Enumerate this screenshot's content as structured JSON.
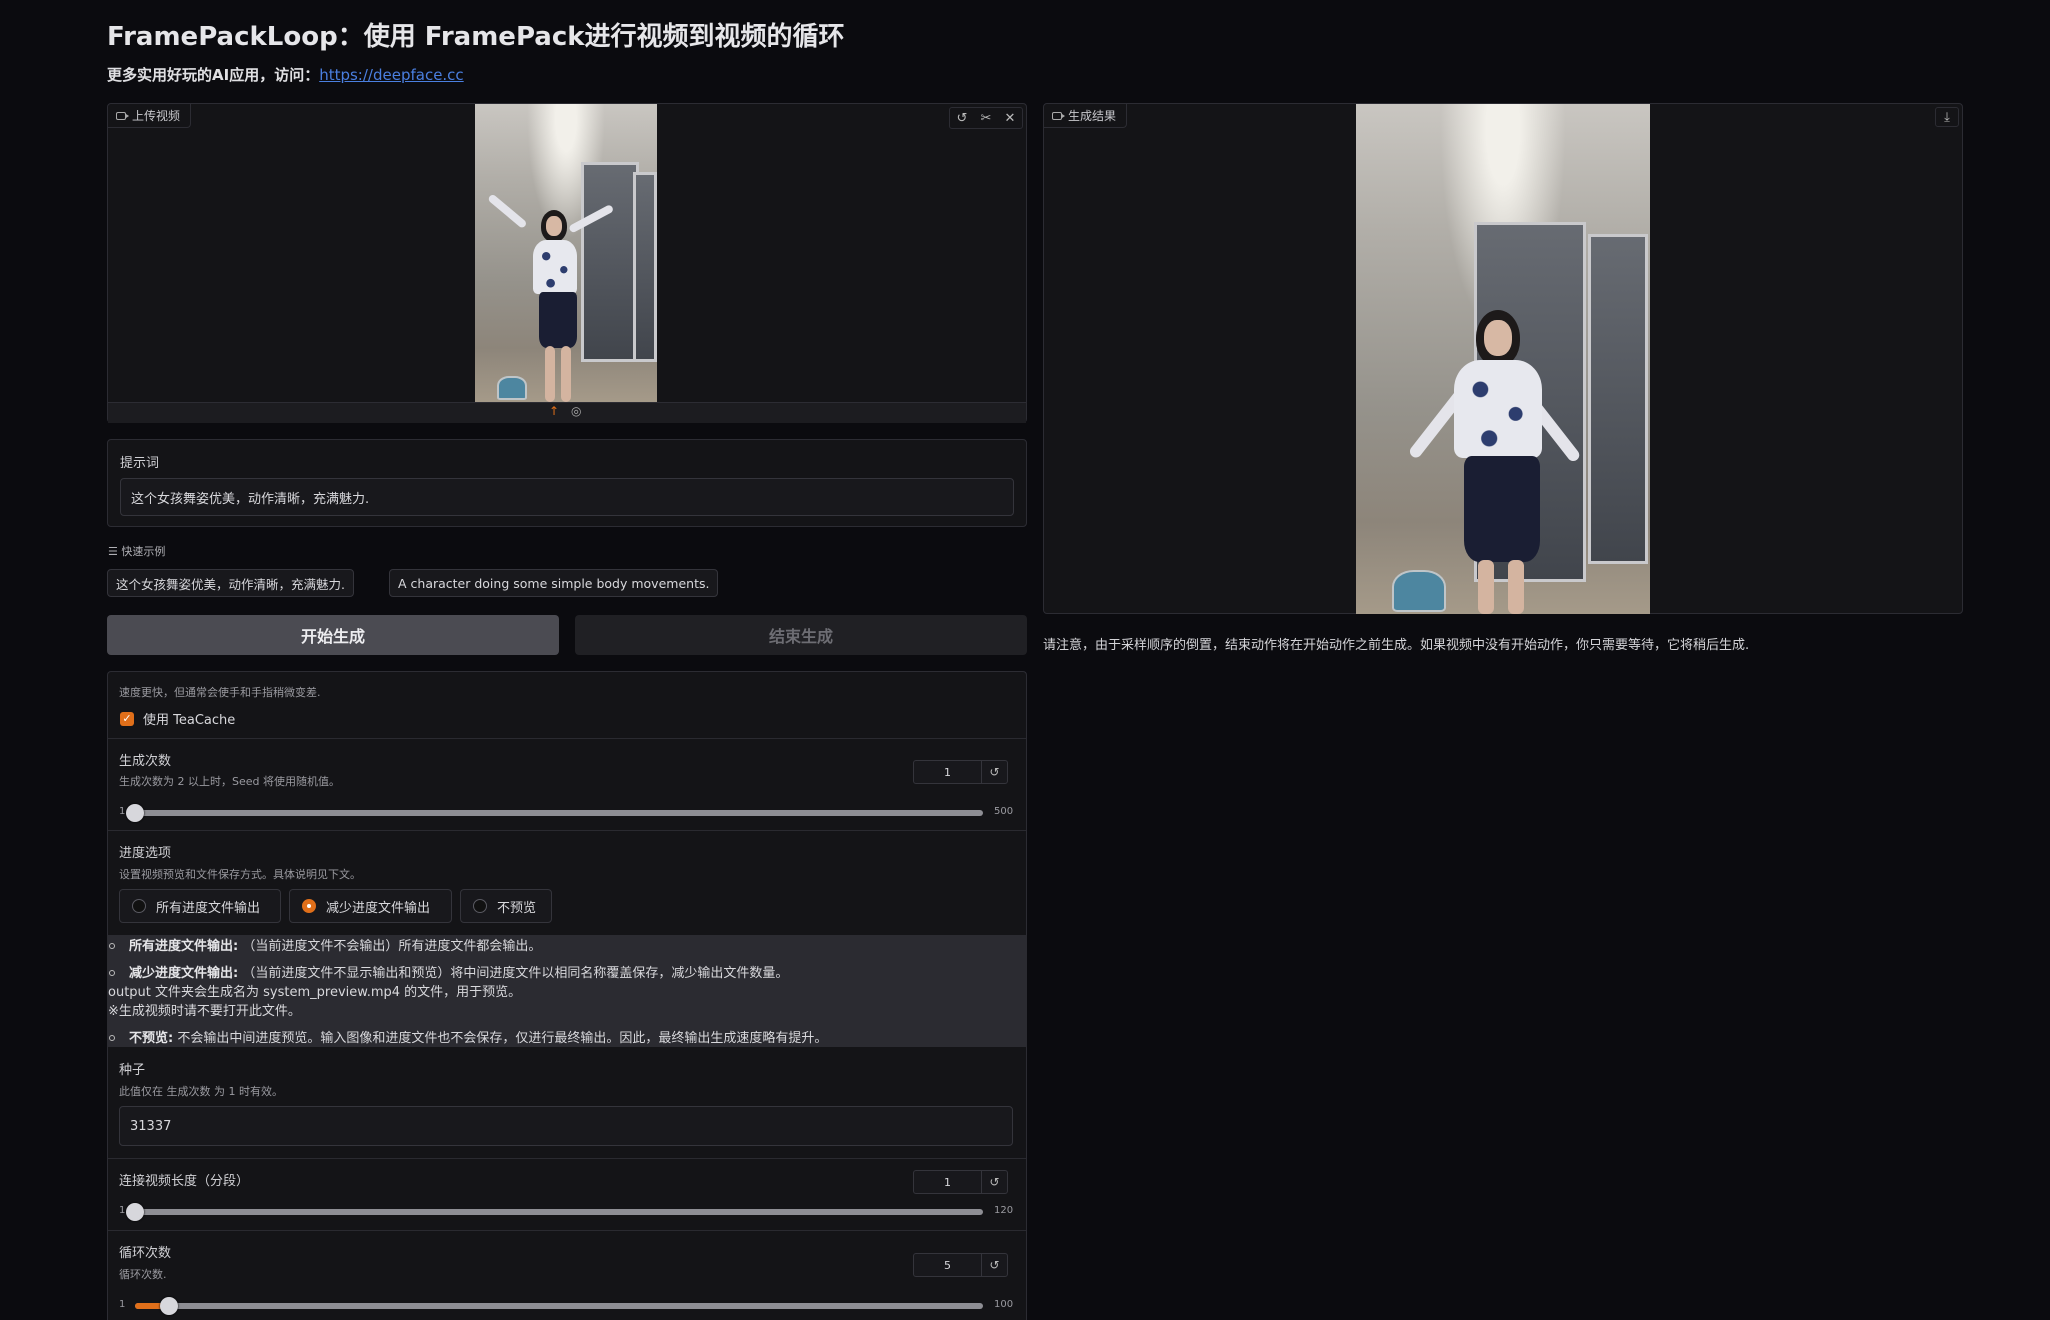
{
  "header": {
    "title": "FramePackLoop：使用 FramePack进行视频到视频的循环",
    "subtitle_prefix": "更多实用好玩的AI应用，访问：",
    "subtitle_link": "https://deepface.cc"
  },
  "upload_video": {
    "label": "上传视频",
    "tools": [
      "undo-icon",
      "scissors-icon",
      "close-icon"
    ],
    "bottom_icons": [
      "upload-icon",
      "camera-icon"
    ]
  },
  "prompt": {
    "label": "提示词",
    "value": "这个女孩舞姿优美，动作清晰，充满魅力."
  },
  "examples": {
    "label": "快速示例",
    "items": [
      "这个女孩舞姿优美，动作清晰，充满魅力.",
      "A character doing some simple body movements."
    ]
  },
  "actions": {
    "start_label": "开始生成",
    "end_label": "结束生成"
  },
  "teacache": {
    "info": "速度更快，但通常会使手和手指稍微变差.",
    "label": "使用 TeaCache",
    "checked": true
  },
  "gen_count": {
    "label": "生成次数",
    "info": "生成次数为 2 以上时，Seed 将使用随机值。",
    "value": "1",
    "min": "1",
    "max": "500",
    "fraction": 0.0
  },
  "progress_option": {
    "label": "进度选项",
    "info": "设置视频预览和文件保存方式。具体说明见下文。",
    "options": [
      "所有进度文件输出",
      "减少进度文件输出",
      "不预览"
    ],
    "selected": "减少进度文件输出"
  },
  "progress_notes": {
    "l1_bold": "所有进度文件输出:",
    "l1_text": "（当前进度文件不会输出）所有进度文件都会输出。",
    "l2_bold": "减少进度文件输出:",
    "l2_text": "（当前进度文件不显示输出和预览）将中间进度文件以相同名称覆盖保存，减少输出文件数量。",
    "l3_text": "output 文件夹会生成名为 system_preview.mp4 的文件，用于预览。",
    "l4_text": "※生成视频时请不要打开此文件。",
    "l5_bold": "不预览:",
    "l5_text": "不会输出中间进度预览。输入图像和进度文件也不会保存，仅进行最终输出。因此，最终输出生成速度略有提升。"
  },
  "seed": {
    "label": "种子",
    "info": "此值仅在 生成次数 为 1 时有效。",
    "value": "31337"
  },
  "connect_length": {
    "label": "连接视频长度（分段）",
    "value": "1",
    "min": "1",
    "max": "120",
    "fraction": 0.0
  },
  "loop_count": {
    "label": "循环次数",
    "info": "循环次数.",
    "value": "5",
    "min": "1",
    "max": "100",
    "fraction": 0.04
  },
  "result": {
    "label": "生成结果",
    "download_icon": "download-icon",
    "note": "请注意，由于采样顺序的倒置，结束动作将在开始动作之前生成。如果视频中没有开始动作，你只需要等待，它将稍后生成."
  },
  "colors": {
    "accent": "#e06f1a",
    "background": "#0b0b0f",
    "link": "#4a7fe0"
  }
}
